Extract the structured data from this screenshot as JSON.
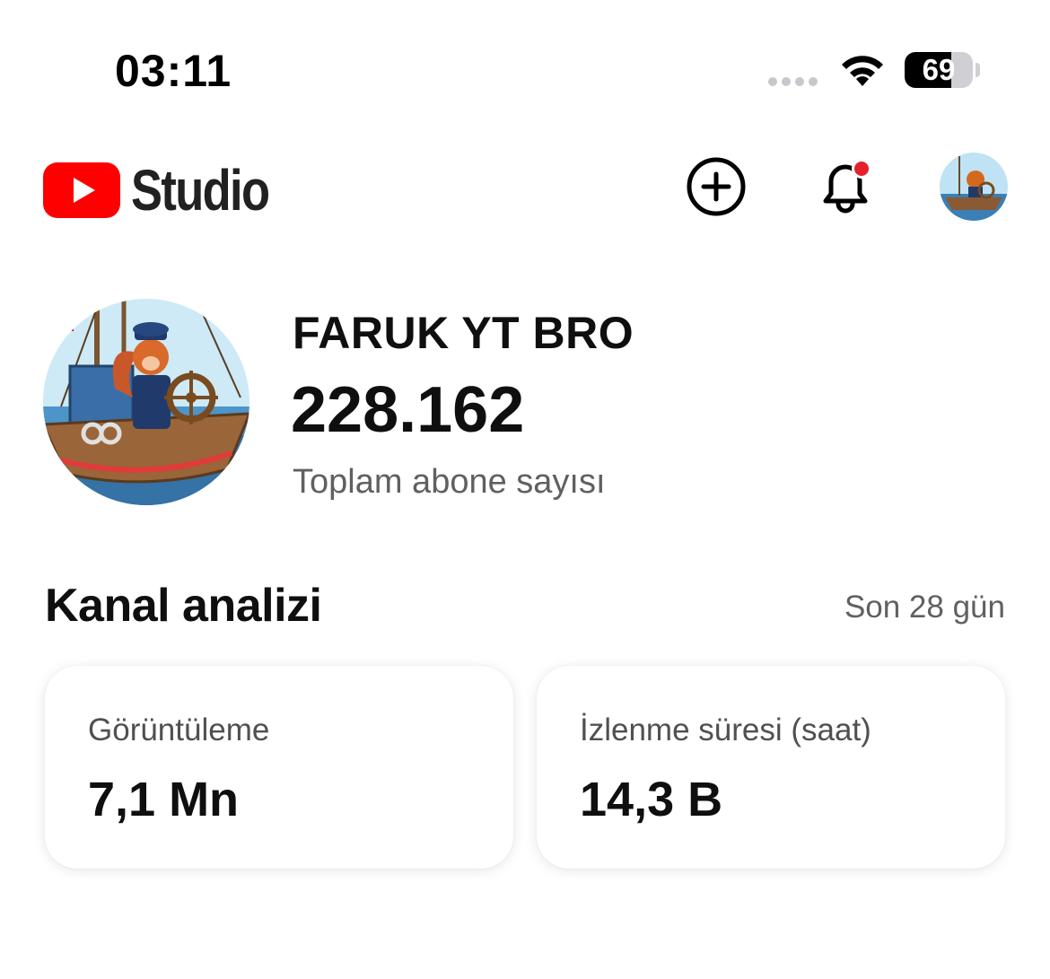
{
  "status_bar": {
    "time": "03:11",
    "battery_percent": "69",
    "battery_level": 0.69,
    "icons": [
      "cellular-signal-icon",
      "wifi-icon",
      "battery-icon"
    ]
  },
  "header": {
    "logo_text": "Studio",
    "brand_color": "#ff0000",
    "icons": [
      "create-icon",
      "notifications-bell-icon",
      "account-avatar"
    ],
    "notification_dot_color": "#e5202b"
  },
  "channel": {
    "name": "FARUK YT BRO",
    "subscriber_count": "228.162",
    "subscriber_label": "Toplam abone sayısı"
  },
  "analytics": {
    "title": "Kanal analizi",
    "period": "Son 28 gün",
    "cards": [
      {
        "label": "Görüntüleme",
        "value": "7,1 Mn"
      },
      {
        "label": "İzlenme süresi (saat)",
        "value": "14,3 B"
      }
    ]
  }
}
